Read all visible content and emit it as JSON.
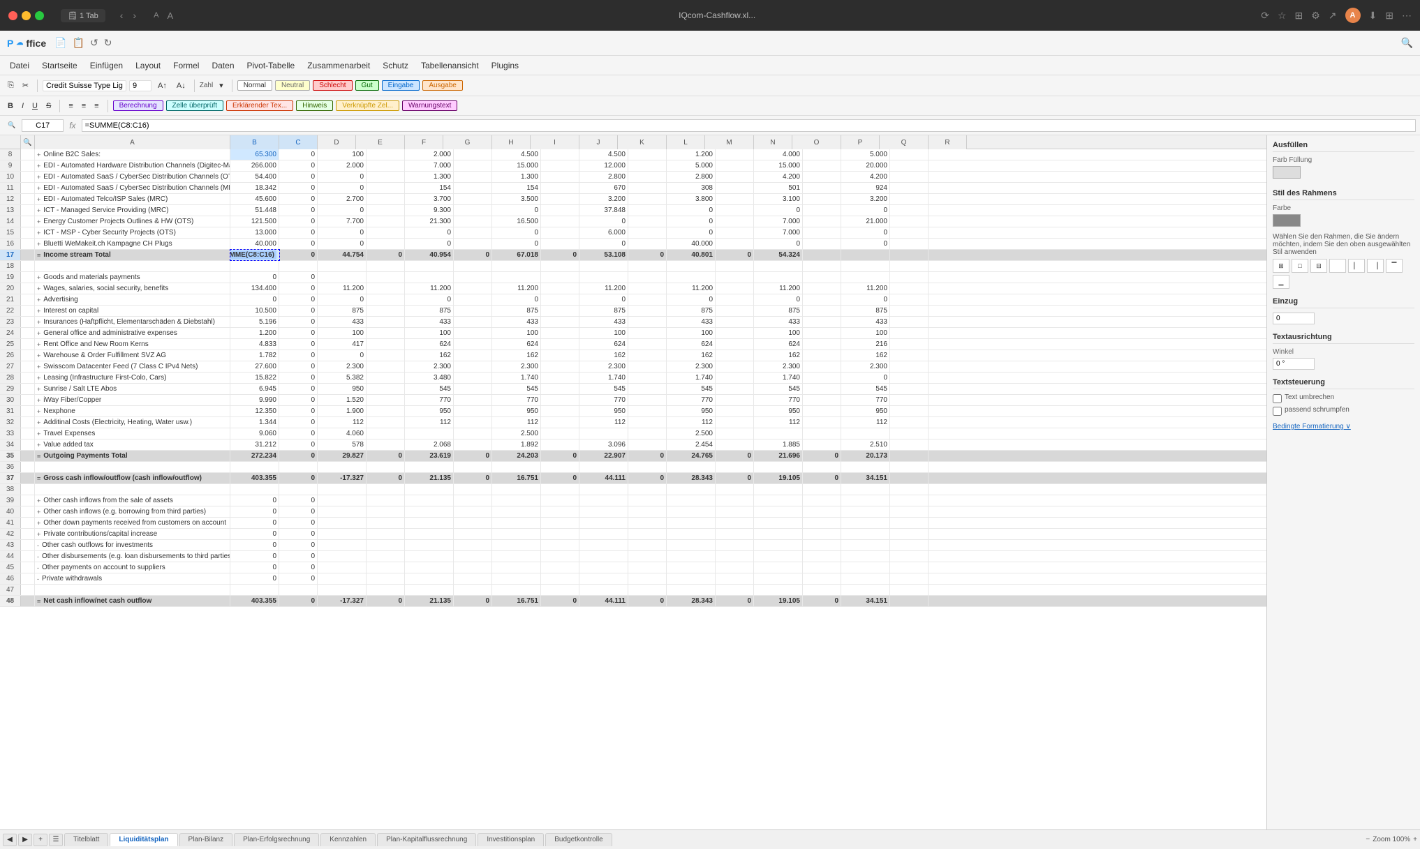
{
  "titlebar": {
    "traffic_lights": [
      "red",
      "yellow",
      "green"
    ],
    "tab": "1 Tab",
    "title": "IQcom-Cashflow.xl...",
    "icons": [
      "↺",
      "⋯"
    ]
  },
  "app": {
    "logo": "P☁office",
    "file_icon": "📄"
  },
  "menubar": {
    "items": [
      "Datei",
      "Startseite",
      "Einfügen",
      "Layout",
      "Formel",
      "Daten",
      "Pivot-Tabelle",
      "Zusammenarbeit",
      "Schutz",
      "Tabellenansicht",
      "Plugins"
    ]
  },
  "toolbar1": {
    "font_name": "Credit Suisse Type Lig-",
    "font_size": "9",
    "number_format": "Zahl"
  },
  "styles": {
    "normal": "Normal",
    "neutral": "Neutral",
    "schlecht": "Schlecht",
    "gut": "Gut",
    "eingabe": "Eingabe",
    "ausgabe": "Ausgabe",
    "berechnung": "Berechnung",
    "zelle": "Zelle überprüft",
    "erklaerend": "Erklärender Tex...",
    "hinweis": "Hinweis",
    "verknuepfte": "Verknüpfte Zel...",
    "warnung": "Warnungstext"
  },
  "formulabar": {
    "cell_ref": "C17",
    "fx": "fx",
    "formula": "=SUMME(C8:C16)"
  },
  "columns": {
    "widths": [
      30,
      20,
      280,
      70,
      55,
      55,
      70,
      55,
      70,
      55,
      70,
      55,
      70,
      55,
      70,
      55,
      70,
      55,
      70,
      55
    ],
    "letters": [
      "",
      "",
      "A",
      "B",
      "C",
      "D",
      "E",
      "F",
      "G",
      "H",
      "I",
      "J",
      "K",
      "L",
      "M",
      "N",
      "O",
      "P",
      "Q",
      "R"
    ]
  },
  "rows": [
    {
      "num": "8",
      "sign": "+",
      "label": "Online B2C Sales:",
      "c": "65.300",
      "d": "0",
      "e": "100",
      "f": "",
      "g": "2.000",
      "h": "",
      "i": "4.500",
      "j": "",
      "k": "4.500",
      "l": "",
      "m": "1.200",
      "n": "",
      "o": "4.000",
      "p": "",
      "q": "5.000",
      "r": "",
      "type": "normal"
    },
    {
      "num": "9",
      "sign": "+",
      "label": "EDI - Automated Hardware Distribution Channels (Digitec-Marlink)",
      "c": "266.000",
      "d": "0",
      "e": "2.000",
      "f": "",
      "g": "7.000",
      "h": "",
      "i": "15.000",
      "j": "",
      "k": "12.000",
      "l": "",
      "m": "5.000",
      "n": "",
      "o": "15.000",
      "p": "",
      "q": "20.000",
      "r": "",
      "type": "normal"
    },
    {
      "num": "10",
      "sign": "+",
      "label": "EDI - Automated SaaS / CyberSec Distribution Channels (OTS",
      "c": "54.400",
      "d": "0",
      "e": "0",
      "f": "",
      "g": "1.300",
      "h": "",
      "i": "1.300",
      "j": "",
      "k": "2.800",
      "l": "",
      "m": "2.800",
      "n": "",
      "o": "4.200",
      "p": "",
      "q": "4.200",
      "r": "",
      "type": "normal"
    },
    {
      "num": "11",
      "sign": "+",
      "label": "EDI - Automated SaaS / CyberSec Distribution Channels (MRC)",
      "c": "18.342",
      "d": "0",
      "e": "0",
      "f": "",
      "g": "154",
      "h": "",
      "i": "154",
      "j": "",
      "k": "670",
      "l": "",
      "m": "308",
      "n": "",
      "o": "501",
      "p": "",
      "q": "924",
      "r": "",
      "type": "normal"
    },
    {
      "num": "12",
      "sign": "+",
      "label": "EDI - Automated Telco/ISP Sales (MRC)",
      "c": "45.600",
      "d": "0",
      "e": "2.700",
      "f": "",
      "g": "3.700",
      "h": "",
      "i": "3.500",
      "j": "",
      "k": "3.200",
      "l": "",
      "m": "3.800",
      "n": "",
      "o": "3.100",
      "p": "",
      "q": "3.200",
      "r": "",
      "type": "normal"
    },
    {
      "num": "13",
      "sign": "+",
      "label": "ICT - Managed Service Providing (MRC)",
      "c": "51.448",
      "d": "0",
      "e": "0",
      "f": "",
      "g": "9.300",
      "h": "",
      "i": "0",
      "j": "",
      "k": "37.848",
      "l": "",
      "m": "0",
      "n": "",
      "o": "0",
      "p": "",
      "q": "0",
      "r": "",
      "type": "normal"
    },
    {
      "num": "14",
      "sign": "+",
      "label": "Energy Customer Projects Outlines & HW (OTS)",
      "c": "121.500",
      "d": "0",
      "e": "7.700",
      "f": "",
      "g": "21.300",
      "h": "",
      "i": "16.500",
      "j": "",
      "k": "0",
      "l": "",
      "m": "0",
      "n": "",
      "o": "7.000",
      "p": "",
      "q": "21.000",
      "r": "",
      "type": "normal"
    },
    {
      "num": "15",
      "sign": "+",
      "label": "ICT - MSP - Cyber Security Projects (OTS)",
      "c": "13.000",
      "d": "0",
      "e": "0",
      "f": "",
      "g": "0",
      "h": "",
      "i": "0",
      "j": "",
      "k": "6.000",
      "l": "",
      "m": "0",
      "n": "",
      "o": "7.000",
      "p": "",
      "q": "0",
      "r": "",
      "type": "normal"
    },
    {
      "num": "16",
      "sign": "+",
      "label": "Bluetti WeMakeit.ch Kampagne CH Plugs",
      "c": "40.000",
      "d": "0",
      "e": "0",
      "f": "",
      "g": "0",
      "h": "",
      "i": "0",
      "j": "",
      "k": "0",
      "l": "",
      "m": "40.000",
      "n": "",
      "o": "0",
      "p": "",
      "q": "0",
      "r": "",
      "type": "normal"
    },
    {
      "num": "17",
      "sign": "=",
      "label": "Income stream Total",
      "c": "=SUMME(C8:C16)",
      "d": "0",
      "e": "44.754",
      "f": "0",
      "g": "40.954",
      "h": "0",
      "i": "67.018",
      "j": "0",
      "k": "53.108",
      "l": "0",
      "m": "40.801",
      "n": "0",
      "o": "54.324",
      "p": "",
      "q": "",
      "r": "",
      "type": "total"
    },
    {
      "num": "18",
      "sign": "",
      "label": "",
      "c": "",
      "d": "",
      "e": "",
      "f": "",
      "g": "",
      "h": "",
      "i": "",
      "j": "",
      "k": "",
      "l": "",
      "m": "",
      "n": "",
      "o": "",
      "p": "",
      "q": "",
      "r": "",
      "type": "empty"
    },
    {
      "num": "19",
      "sign": "+",
      "label": "Goods and materials payments",
      "c": "0",
      "d": "0",
      "e": "",
      "f": "",
      "g": "",
      "h": "",
      "i": "",
      "j": "",
      "k": "",
      "l": "",
      "m": "",
      "n": "",
      "o": "",
      "p": "",
      "q": "",
      "r": "",
      "type": "normal"
    },
    {
      "num": "20",
      "sign": "+",
      "label": "Wages, salaries, social security, benefits",
      "c": "134.400",
      "d": "0",
      "e": "11.200",
      "f": "",
      "g": "11.200",
      "h": "",
      "i": "11.200",
      "j": "",
      "k": "11.200",
      "l": "",
      "m": "11.200",
      "n": "",
      "o": "11.200",
      "p": "",
      "q": "11.200",
      "r": "",
      "type": "normal"
    },
    {
      "num": "21",
      "sign": "+",
      "label": "Advertising",
      "c": "0",
      "d": "0",
      "e": "0",
      "f": "",
      "g": "0",
      "h": "",
      "i": "0",
      "j": "",
      "k": "0",
      "l": "",
      "m": "0",
      "n": "",
      "o": "0",
      "p": "",
      "q": "0",
      "r": "",
      "type": "normal"
    },
    {
      "num": "22",
      "sign": "+",
      "label": "Interest on capital",
      "c": "10.500",
      "d": "0",
      "e": "875",
      "f": "",
      "g": "875",
      "h": "",
      "i": "875",
      "j": "",
      "k": "875",
      "l": "",
      "m": "875",
      "n": "",
      "o": "875",
      "p": "",
      "q": "875",
      "r": "",
      "type": "normal"
    },
    {
      "num": "23",
      "sign": "+",
      "label": "Insurances (Haftpflicht, Elementarschäden & Diebstahl)",
      "c": "5.196",
      "d": "0",
      "e": "433",
      "f": "",
      "g": "433",
      "h": "",
      "i": "433",
      "j": "",
      "k": "433",
      "l": "",
      "m": "433",
      "n": "",
      "o": "433",
      "p": "",
      "q": "433",
      "r": "",
      "type": "normal"
    },
    {
      "num": "24",
      "sign": "+",
      "label": "General office and administrative expenses",
      "c": "1.200",
      "d": "0",
      "e": "100",
      "f": "",
      "g": "100",
      "h": "",
      "i": "100",
      "j": "",
      "k": "100",
      "l": "",
      "m": "100",
      "n": "",
      "o": "100",
      "p": "",
      "q": "100",
      "r": "",
      "type": "normal"
    },
    {
      "num": "25",
      "sign": "+",
      "label": "Rent Office and New Room Kerns",
      "c": "4.833",
      "d": "0",
      "e": "417",
      "f": "",
      "g": "624",
      "h": "",
      "i": "624",
      "j": "",
      "k": "624",
      "l": "",
      "m": "624",
      "n": "",
      "o": "624",
      "p": "",
      "q": "216",
      "r": "",
      "type": "normal"
    },
    {
      "num": "26",
      "sign": "+",
      "label": "Warehouse & Order Fulfillment SVZ AG",
      "c": "1.782",
      "d": "0",
      "e": "0",
      "f": "",
      "g": "162",
      "h": "",
      "i": "162",
      "j": "",
      "k": "162",
      "l": "",
      "m": "162",
      "n": "",
      "o": "162",
      "p": "",
      "q": "162",
      "r": "",
      "type": "normal"
    },
    {
      "num": "27",
      "sign": "+",
      "label": "Swisscom Datacenter Feed (7 Class C IPv4 Nets)",
      "c": "27.600",
      "d": "0",
      "e": "2.300",
      "f": "",
      "g": "2.300",
      "h": "",
      "i": "2.300",
      "j": "",
      "k": "2.300",
      "l": "",
      "m": "2.300",
      "n": "",
      "o": "2.300",
      "p": "",
      "q": "2.300",
      "r": "",
      "type": "normal"
    },
    {
      "num": "28",
      "sign": "+",
      "label": "Leasing (Infrastructure First-Colo, Cars)",
      "c": "15.822",
      "d": "0",
      "e": "5.382",
      "f": "",
      "g": "3.480",
      "h": "",
      "i": "1.740",
      "j": "",
      "k": "1.740",
      "l": "",
      "m": "1.740",
      "n": "",
      "o": "1.740",
      "p": "",
      "q": "0",
      "r": "",
      "type": "normal"
    },
    {
      "num": "29",
      "sign": "+",
      "label": "Sunrise / Salt LTE Abos",
      "c": "6.945",
      "d": "0",
      "e": "950",
      "f": "",
      "g": "545",
      "h": "",
      "i": "545",
      "j": "",
      "k": "545",
      "l": "",
      "m": "545",
      "n": "",
      "o": "545",
      "p": "",
      "q": "545",
      "r": "",
      "type": "normal"
    },
    {
      "num": "30",
      "sign": "+",
      "label": "iWay Fiber/Copper",
      "c": "9.990",
      "d": "0",
      "e": "1.520",
      "f": "",
      "g": "770",
      "h": "",
      "i": "770",
      "j": "",
      "k": "770",
      "l": "",
      "m": "770",
      "n": "",
      "o": "770",
      "p": "",
      "q": "770",
      "r": "",
      "type": "normal"
    },
    {
      "num": "31",
      "sign": "+",
      "label": "Nexphone",
      "c": "12.350",
      "d": "0",
      "e": "1.900",
      "f": "",
      "g": "950",
      "h": "",
      "i": "950",
      "j": "",
      "k": "950",
      "l": "",
      "m": "950",
      "n": "",
      "o": "950",
      "p": "",
      "q": "950",
      "r": "",
      "type": "normal"
    },
    {
      "num": "32",
      "sign": "+",
      "label": "Additinal Costs (Electricity, Heating, Water usw.)",
      "c": "1.344",
      "d": "0",
      "e": "112",
      "f": "",
      "g": "112",
      "h": "",
      "i": "112",
      "j": "",
      "k": "112",
      "l": "",
      "m": "112",
      "n": "",
      "o": "112",
      "p": "",
      "q": "112",
      "r": "",
      "type": "normal"
    },
    {
      "num": "33",
      "sign": "+",
      "label": "Travel Expenses",
      "c": "9.060",
      "d": "0",
      "e": "4.060",
      "f": "",
      "g": "",
      "h": "",
      "i": "2.500",
      "j": "",
      "k": "",
      "l": "",
      "m": "2.500",
      "n": "",
      "o": "",
      "p": "",
      "q": "",
      "r": "",
      "type": "normal"
    },
    {
      "num": "34",
      "sign": "+",
      "label": "Value added tax",
      "c": "31.212",
      "d": "0",
      "e": "578",
      "f": "",
      "g": "2.068",
      "h": "",
      "i": "1.892",
      "j": "",
      "k": "3.096",
      "l": "",
      "m": "2.454",
      "n": "",
      "o": "1.885",
      "p": "",
      "q": "2.510",
      "r": "",
      "type": "normal"
    },
    {
      "num": "35",
      "sign": "=",
      "label": "Outgoing Payments Total",
      "c": "272.234",
      "d": "0",
      "e": "29.827",
      "f": "0",
      "g": "23.619",
      "h": "0",
      "i": "24.203",
      "j": "0",
      "k": "22.907",
      "l": "0",
      "m": "24.765",
      "n": "0",
      "o": "21.696",
      "p": "0",
      "q": "20.173",
      "r": "",
      "type": "total"
    },
    {
      "num": "36",
      "sign": "",
      "label": "",
      "c": "",
      "d": "",
      "e": "",
      "f": "",
      "g": "",
      "h": "",
      "i": "",
      "j": "",
      "k": "",
      "l": "",
      "m": "",
      "n": "",
      "o": "",
      "p": "",
      "q": "",
      "r": "",
      "type": "empty"
    },
    {
      "num": "37",
      "sign": "=",
      "label": "Gross cash inflow/outflow (cash inflow/outflow)",
      "c": "403.355",
      "d": "0",
      "e": "-17.327",
      "f": "0",
      "g": "21.135",
      "h": "0",
      "i": "16.751",
      "j": "0",
      "k": "44.111",
      "l": "0",
      "m": "28.343",
      "n": "0",
      "o": "19.105",
      "p": "0",
      "q": "34.151",
      "r": "",
      "type": "total"
    },
    {
      "num": "38",
      "sign": "",
      "label": "",
      "c": "",
      "d": "",
      "e": "",
      "f": "",
      "g": "",
      "h": "",
      "i": "",
      "j": "",
      "k": "",
      "l": "",
      "m": "",
      "n": "",
      "o": "",
      "p": "",
      "q": "",
      "r": "",
      "type": "empty"
    },
    {
      "num": "39",
      "sign": "+",
      "label": "Other cash inflows from the sale of assets",
      "c": "0",
      "d": "0",
      "e": "",
      "f": "",
      "g": "",
      "h": "",
      "i": "",
      "j": "",
      "k": "",
      "l": "",
      "m": "",
      "n": "",
      "o": "",
      "p": "",
      "q": "",
      "r": "",
      "type": "normal"
    },
    {
      "num": "40",
      "sign": "+",
      "label": "Other cash inflows (e.g. borrowing from third parties)",
      "c": "0",
      "d": "0",
      "e": "",
      "f": "",
      "g": "",
      "h": "",
      "i": "",
      "j": "",
      "k": "",
      "l": "",
      "m": "",
      "n": "",
      "o": "",
      "p": "",
      "q": "",
      "r": "",
      "type": "normal"
    },
    {
      "num": "41",
      "sign": "+",
      "label": "Other down payments received from customers on account",
      "c": "0",
      "d": "0",
      "e": "",
      "f": "",
      "g": "",
      "h": "",
      "i": "",
      "j": "",
      "k": "",
      "l": "",
      "m": "",
      "n": "",
      "o": "",
      "p": "",
      "q": "",
      "r": "",
      "type": "normal"
    },
    {
      "num": "42",
      "sign": "+",
      "label": "Private contributions/capital increase",
      "c": "0",
      "d": "0",
      "e": "",
      "f": "",
      "g": "",
      "h": "",
      "i": "",
      "j": "",
      "k": "",
      "l": "",
      "m": "",
      "n": "",
      "o": "",
      "p": "",
      "q": "",
      "r": "",
      "type": "normal"
    },
    {
      "num": "43",
      "sign": "-",
      "label": "Other cash outflows for investments",
      "c": "0",
      "d": "0",
      "e": "",
      "f": "",
      "g": "",
      "h": "",
      "i": "",
      "j": "",
      "k": "",
      "l": "",
      "m": "",
      "n": "",
      "o": "",
      "p": "",
      "q": "",
      "r": "",
      "type": "normal"
    },
    {
      "num": "44",
      "sign": "-",
      "label": "Other disbursements (e.g. loan disbursements to third parties)",
      "c": "0",
      "d": "0",
      "e": "",
      "f": "",
      "g": "",
      "h": "",
      "i": "",
      "j": "",
      "k": "",
      "l": "",
      "m": "",
      "n": "",
      "o": "",
      "p": "",
      "q": "",
      "r": "",
      "type": "normal"
    },
    {
      "num": "45",
      "sign": "-",
      "label": "Other payments on account to suppliers",
      "c": "0",
      "d": "0",
      "e": "",
      "f": "",
      "g": "",
      "h": "",
      "i": "",
      "j": "",
      "k": "",
      "l": "",
      "m": "",
      "n": "",
      "o": "",
      "p": "",
      "q": "",
      "r": "",
      "type": "normal"
    },
    {
      "num": "46",
      "sign": "-",
      "label": "Private withdrawals",
      "c": "0",
      "d": "0",
      "e": "",
      "f": "",
      "g": "",
      "h": "",
      "i": "",
      "j": "",
      "k": "",
      "l": "",
      "m": "",
      "n": "",
      "o": "",
      "p": "",
      "q": "",
      "r": "",
      "type": "normal"
    },
    {
      "num": "47",
      "sign": "",
      "label": "",
      "c": "",
      "d": "",
      "e": "",
      "f": "",
      "g": "",
      "h": "",
      "i": "",
      "j": "",
      "k": "",
      "l": "",
      "m": "",
      "n": "",
      "o": "",
      "p": "",
      "q": "",
      "r": "",
      "type": "empty"
    },
    {
      "num": "48",
      "sign": "=",
      "label": "Net cash inflow/net cash outflow",
      "c": "403.355",
      "d": "0",
      "e": "-17.327",
      "f": "0",
      "g": "21.135",
      "h": "0",
      "i": "16.751",
      "j": "0",
      "k": "44.111",
      "l": "0",
      "m": "28.343",
      "n": "0",
      "o": "19.105",
      "p": "0",
      "q": "34.151",
      "r": "",
      "type": "total"
    }
  ],
  "right_panel": {
    "fill_title": "Ausfüllen",
    "fill_color_label": "Farb Füllung",
    "border_title": "Stil des Rahmens",
    "border_color_label": "Farbe",
    "border_desc": "Wählen Sie den Rahmen, die Sie ändern möchten, indem Sie den oben ausgewählten Stil anwenden",
    "indent_title": "Einzug",
    "indent_value": "0",
    "align_title": "Textausrichtung",
    "angle_title": "Winkel",
    "angle_value": "0 °",
    "wrap_title": "Textsteuerung",
    "wrap_option": "Text umbrechen",
    "shrink_option": "passend schrumpfen",
    "format_link": "Bedingte Formatierung ∨"
  },
  "bottom_tabs": {
    "tabs": [
      "Titelblatt",
      "Liquiditätsplan",
      "Plan-Bilanz",
      "Plan-Erfolgsrechnung",
      "Kennzahlen",
      "Plan-Kapitalflussrechnung",
      "Investitionsplan",
      "Budgetkontrolle"
    ],
    "active_tab": "Liquiditätsplan",
    "zoom": "Zoom 100%"
  }
}
